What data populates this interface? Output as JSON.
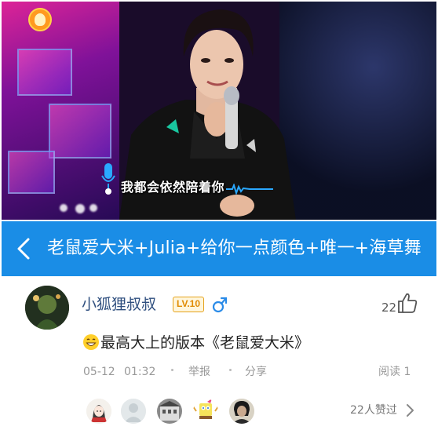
{
  "video": {
    "lyric_sung": "我都会",
    "lyric_unsung": "依然陪着你",
    "icons": {
      "logo": "mango-tv-logo",
      "mic": "microphone-icon",
      "wave": "voice-wave-icon"
    }
  },
  "titlebar": {
    "song_title": "老鼠爱大米+Julia+给你一点颜色+唯一+海草舞",
    "back_icon": "chevron-left-icon",
    "background": "#1a8de6"
  },
  "comment": {
    "username": "小狐狸叔叔",
    "level": "LV.10",
    "gender_icon": "male-icon",
    "like_count": "22",
    "text": "最高大上的版本《老鼠爱大米》",
    "emoji": "grinning-face-emoji",
    "date": "05-12",
    "time": "01:32",
    "report_label": "举报",
    "share_label": "分享",
    "read_label": "阅读 1",
    "colors": {
      "username": "#2f4f7f",
      "level": "#e08a00",
      "gender": "#2a8be8"
    }
  },
  "likes": {
    "summary": "22人赞过",
    "avatars": [
      "avatar-girl-sketch",
      "avatar-default",
      "avatar-building",
      "avatar-spongebob",
      "avatar-man-portrait"
    ]
  }
}
